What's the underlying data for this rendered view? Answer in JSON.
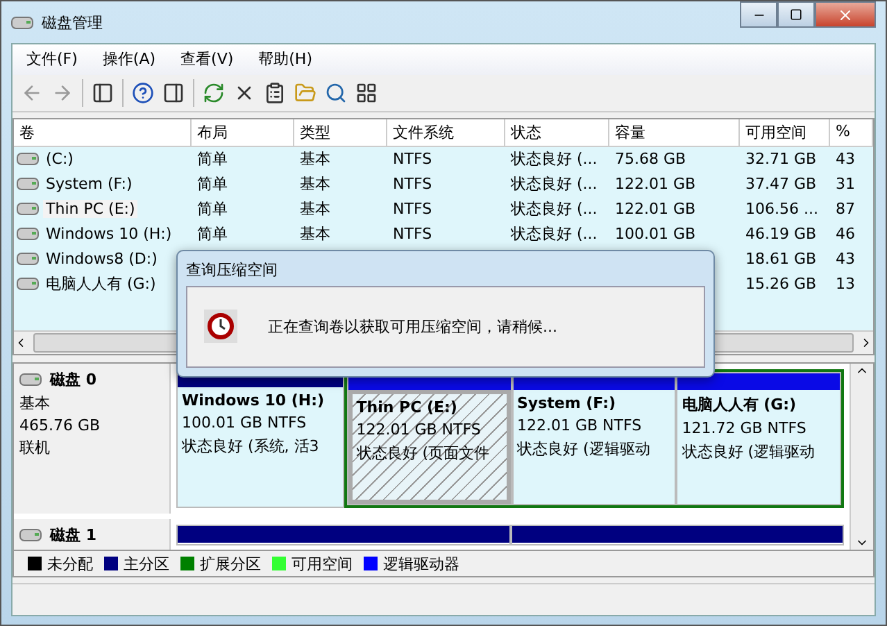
{
  "window": {
    "title": "磁盘管理"
  },
  "menu": [
    {
      "label": "文件(F)"
    },
    {
      "label": "操作(A)"
    },
    {
      "label": "查看(V)"
    },
    {
      "label": "帮助(H)"
    }
  ],
  "table": {
    "columns": [
      "卷",
      "布局",
      "类型",
      "文件系统",
      "状态",
      "容量",
      "可用空间",
      "%"
    ],
    "rows": [
      {
        "volume": "(C:)",
        "layout": "简单",
        "type": "基本",
        "fs": "NTFS",
        "status": "状态良好 (...",
        "capacity": "75.68 GB",
        "free": "32.71 GB",
        "pct": "43",
        "selected": false
      },
      {
        "volume": "System (F:)",
        "layout": "简单",
        "type": "基本",
        "fs": "NTFS",
        "status": "状态良好 (...",
        "capacity": "122.01 GB",
        "free": "37.47 GB",
        "pct": "31",
        "selected": false
      },
      {
        "volume": "Thin PC (E:)",
        "layout": "简单",
        "type": "基本",
        "fs": "NTFS",
        "status": "状态良好 (...",
        "capacity": "122.01 GB",
        "free": "106.56 ...",
        "pct": "87",
        "selected": true
      },
      {
        "volume": "Windows 10 (H:)",
        "layout": "简单",
        "type": "基本",
        "fs": "NTFS",
        "status": "状态良好 (...",
        "capacity": "100.01 GB",
        "free": "46.19 GB",
        "pct": "46",
        "selected": false
      },
      {
        "volume": "Windows8 (D:)",
        "free": "18.61 GB",
        "pct": "43",
        "selected": false
      },
      {
        "volume": "电脑人人有 (G:)",
        "free": "15.26 GB",
        "pct": "13",
        "selected": false
      }
    ]
  },
  "dialog": {
    "title": "查询压缩空间",
    "message": "正在查询卷以获取可用压缩空间，请稍候..."
  },
  "disks": [
    {
      "name": "磁盘 0",
      "type": "基本",
      "size": "465.76 GB",
      "state": "联机",
      "partitions": [
        {
          "kind": "primary",
          "name": "Windows 10  (H:)",
          "size": "100.01 GB NTFS",
          "status": "状态良好 (系统, 活3",
          "selected": false
        },
        {
          "kind": "logical",
          "name": "Thin PC  (E:)",
          "size": "122.01 GB NTFS",
          "status": "状态良好 (页面文件",
          "selected": true
        },
        {
          "kind": "logical",
          "name": "System  (F:)",
          "size": "122.01 GB NTFS",
          "status": "状态良好 (逻辑驱动",
          "selected": false
        },
        {
          "kind": "logical",
          "name": "电脑人人有  (G:)",
          "size": "121.72 GB NTFS",
          "status": "状态良好 (逻辑驱动",
          "selected": false
        }
      ]
    },
    {
      "name": "磁盘 1",
      "partitions": [
        {
          "kind": "primary"
        },
        {
          "kind": "primary"
        }
      ]
    }
  ],
  "legend": [
    {
      "label": "未分配",
      "color": "#000000"
    },
    {
      "label": "主分区",
      "color": "#000080"
    },
    {
      "label": "扩展分区",
      "color": "#008000"
    },
    {
      "label": "可用空间",
      "color": "#33ff33"
    },
    {
      "label": "逻辑驱动器",
      "color": "#0000ff"
    }
  ]
}
